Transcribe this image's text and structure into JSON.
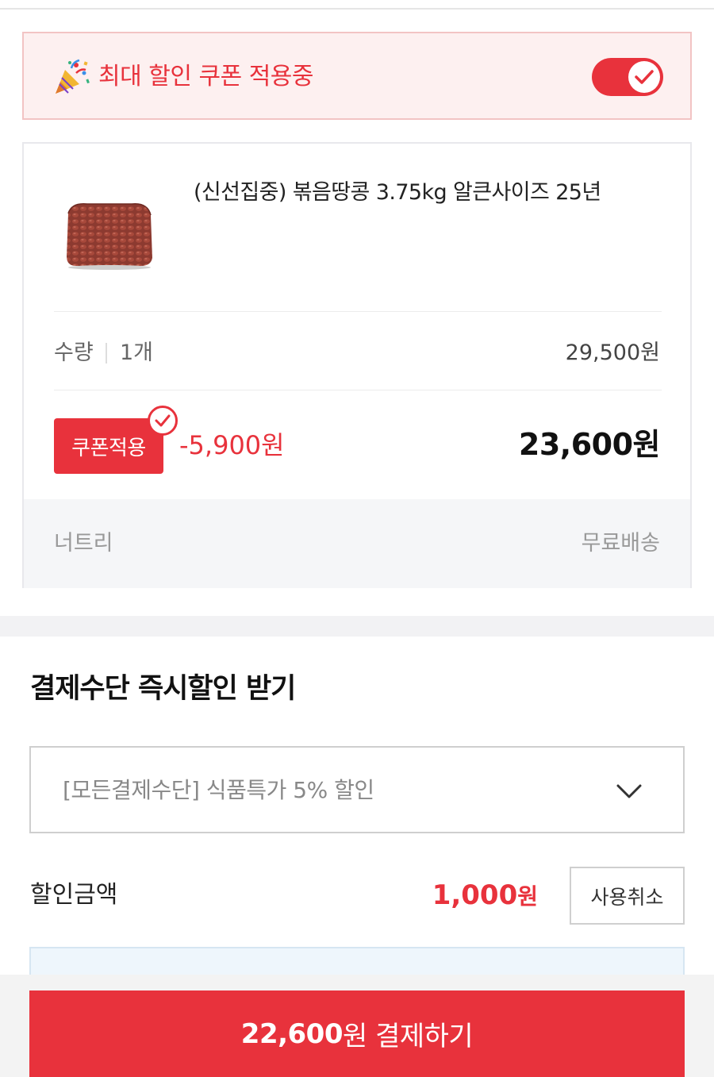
{
  "coupon_banner": {
    "text": "최대 할인 쿠폰 적용중",
    "toggle_on": true,
    "accent": "#e8323c"
  },
  "product": {
    "name": "(신선집중) 볶음땅콩 3.75kg 알큰사이즈 25년",
    "qty_label": "수량",
    "qty_value": "1개",
    "original_price": "29,500원",
    "coupon_label": "쿠폰적용",
    "discount": "-5,900원",
    "final_price": "23,600원",
    "seller": "너트리",
    "shipping": "무료배송"
  },
  "payment_discount": {
    "title": "결제수단 즉시할인 받기",
    "selected_option": "[모든결제수단] 식품특가 5% 할인",
    "amount_label": "할인금액",
    "amount_number": "1,000",
    "amount_unit": "원",
    "cancel_label": "사용취소"
  },
  "checkout": {
    "amount": "22,600",
    "label": "원 결제하기"
  },
  "icons": {
    "banner": "party-popper-icon",
    "toggle": "checkmark-icon",
    "select": "chevron-down-icon"
  }
}
